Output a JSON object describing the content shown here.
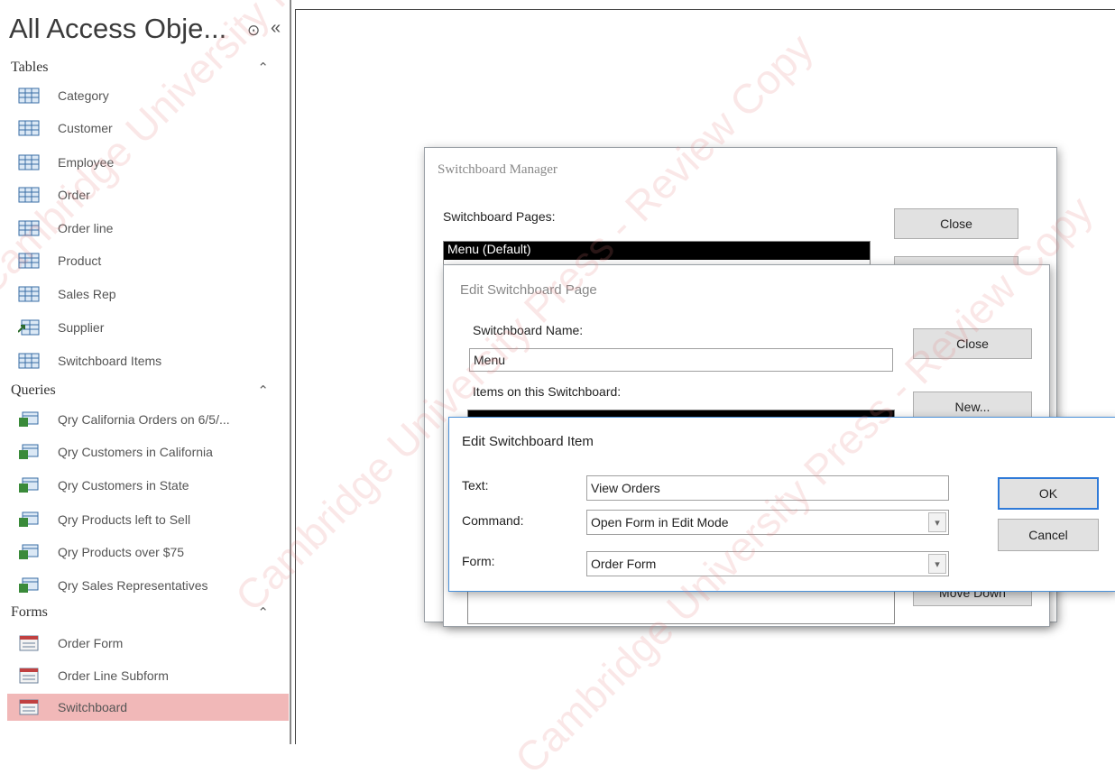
{
  "navpane": {
    "title": "All Access Obje...",
    "menu_icon": "chevron-circle-down-icon",
    "shutter_icon": "double-chevron-left-icon",
    "groups": [
      {
        "label": "Tables",
        "items": [
          "Category",
          "Customer",
          "Employee",
          "Order",
          "Order line",
          "Product",
          "Sales Rep",
          "Supplier",
          "Switchboard Items"
        ]
      },
      {
        "label": "Queries",
        "items": [
          "Qry California Orders on 6/5/...",
          "Qry Customers in California",
          "Qry Customers in State",
          "Qry Products left to Sell",
          "Qry Products over $75",
          "Qry Sales Representatives"
        ]
      },
      {
        "label": "Forms",
        "items": [
          "Order Form",
          "Order Line Subform",
          "Switchboard"
        ]
      }
    ],
    "selected_item": "Switchboard"
  },
  "switchboard_manager": {
    "title": "Switchboard Manager",
    "pages_label": "Switchboard Pages:",
    "pages": [
      "Menu (Default)"
    ],
    "close_label": "Close"
  },
  "edit_page": {
    "title": "Edit Switchboard Page",
    "name_label": "Switchboard Name:",
    "name_value": "Menu",
    "items_label": "Items on this Switchboard:",
    "close_label": "Close",
    "new_label": "New...",
    "move_down_label": "Move Down"
  },
  "edit_item": {
    "title": "Edit Switchboard Item",
    "text_label": "Text:",
    "text_value": "View Orders",
    "command_label": "Command:",
    "command_value": "Open Form in Edit Mode",
    "form_label": "Form:",
    "form_value": "Order Form",
    "ok_label": "OK",
    "cancel_label": "Cancel"
  },
  "watermark": {
    "lines": [
      "Cambridge University Press - Review Copy",
      "Cambridge University Press - Review Copy",
      "Cambridge University Press - Review Copy"
    ]
  },
  "colors": {
    "selection": "#f1b8b8",
    "accent": "#2f7ad8"
  }
}
